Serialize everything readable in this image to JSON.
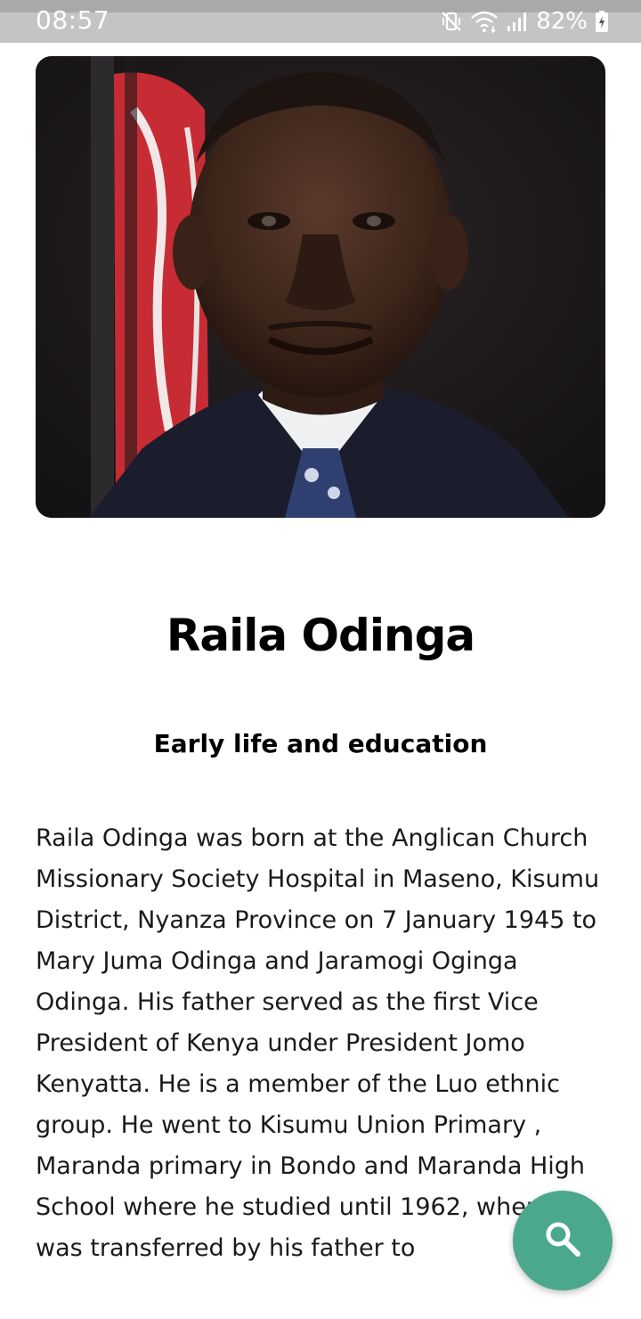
{
  "status_bar": {
    "time": "08:57",
    "battery_percent": "82%",
    "icons": [
      "vibrate-mute-icon",
      "wifi-icon",
      "signal-icon",
      "battery-charging-icon"
    ]
  },
  "article": {
    "portrait_icon": "portrait-photo",
    "name": "Raila Odinga",
    "section_heading": "Early life and education",
    "body": "Raila Odinga was born at the Anglican Church Missionary Society Hospital in Maseno, Kisumu District, Nyanza Province on 7 January 1945 to Mary Juma Odinga and Jaramogi Oginga Odinga. His father served as the first Vice President of Kenya under President Jomo Kenyatta. He is a member of the Luo ethnic group. He went to Kisumu Union Primary , Maranda primary in Bondo and Maranda High School where he studied until 1962, when he was transferred by his father to"
  },
  "fab": {
    "icon": "search-icon",
    "color": "#4ba88d"
  }
}
